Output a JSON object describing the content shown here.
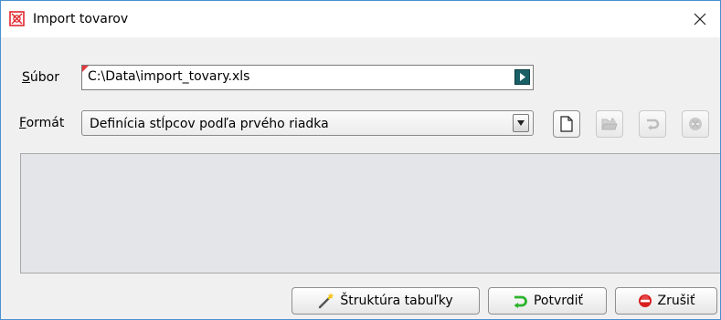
{
  "window": {
    "title": "Import tovarov",
    "close_symbol": "✕"
  },
  "file_row": {
    "label_first": "S",
    "label_rest": "úbor",
    "value": "C:\\Data\\import_tovary.xls",
    "browse_icon": "play-arrow-icon"
  },
  "format_row": {
    "label_first": "F",
    "label_rest": "ormát",
    "selected": "Definícia stĺpcov podľa prvého riadka"
  },
  "toolbar": {
    "icons": [
      "new-document-icon",
      "open-folder-icon",
      "undo-icon",
      "delete-icon"
    ]
  },
  "actions": {
    "structure_label": "Štruktúra tabuľky",
    "confirm_label": "Potvrdiť",
    "cancel_label": "Zrušiť"
  },
  "colors": {
    "window_border": "#4a8fd0",
    "required_mark": "#e5393d",
    "browse_button": "#1a5f66",
    "confirm_icon": "#2bb32b",
    "cancel_icon": "#d81e1e"
  }
}
